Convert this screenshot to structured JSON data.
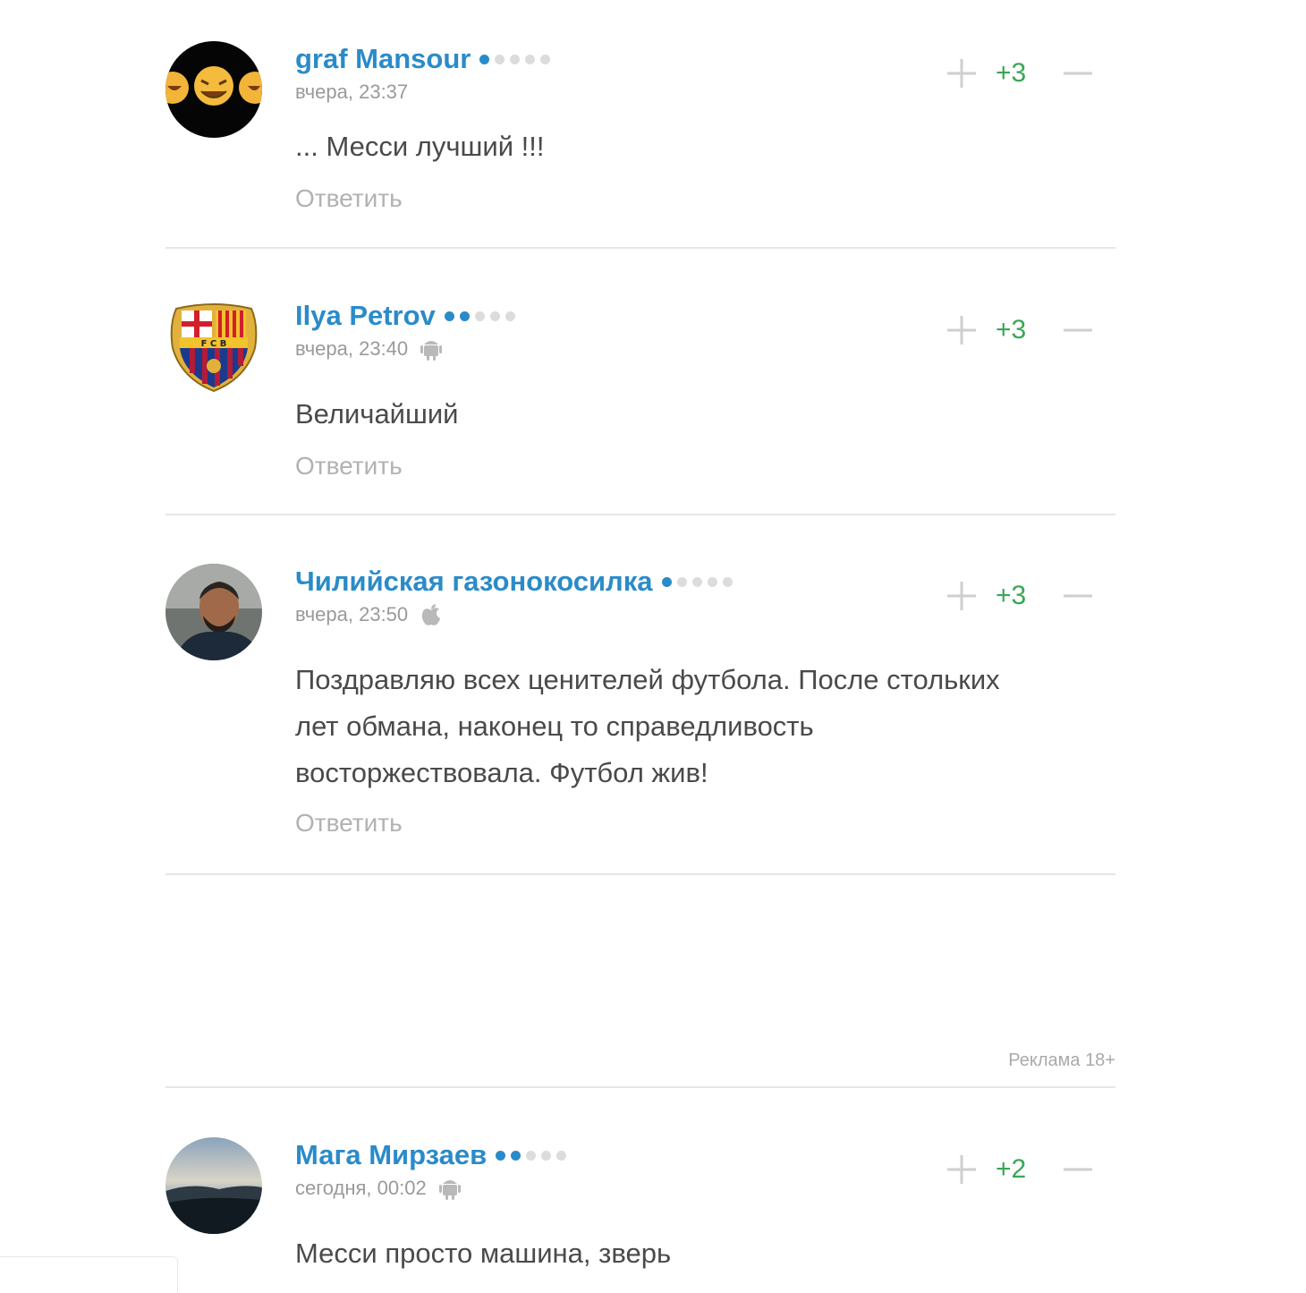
{
  "reply_label": "Ответить",
  "ad_label": "Реклама 18+",
  "colors": {
    "accent": "#2a8bc9",
    "positive": "#3aa655",
    "muted": "#9a9a9a"
  },
  "comments": [
    {
      "author": "graf Mansour",
      "rating_filled": 1,
      "rating_total": 5,
      "timestamp": "вчера, 23:37",
      "device_icon": "none",
      "avatar": "emoji-faces-avatar",
      "text": "... Месси лучший !!!",
      "score": "+3"
    },
    {
      "author": "Ilya Petrov",
      "rating_filled": 2,
      "rating_total": 5,
      "timestamp": "вчера, 23:40",
      "device_icon": "android-icon",
      "avatar": "fcb-crest-avatar",
      "text": "Величайший",
      "score": "+3"
    },
    {
      "author": "Чилийская газонокосилка",
      "rating_filled": 1,
      "rating_total": 5,
      "timestamp": "вчера, 23:50",
      "device_icon": "apple-icon",
      "avatar": "player-photo-avatar",
      "text_lines": [
        "Поздравляю всех ценителей футбола. После стольких",
        "лет обмана, наконец то справедливость",
        "восторжествовала. Футбол жив!"
      ],
      "score": "+3"
    },
    {
      "author": "Мага Мирзаев",
      "rating_filled": 2,
      "rating_total": 5,
      "timestamp": "сегодня, 00:02",
      "device_icon": "android-icon",
      "avatar": "sunset-landscape-avatar",
      "text": "Месси просто машина, зверь",
      "score": "+2"
    }
  ]
}
